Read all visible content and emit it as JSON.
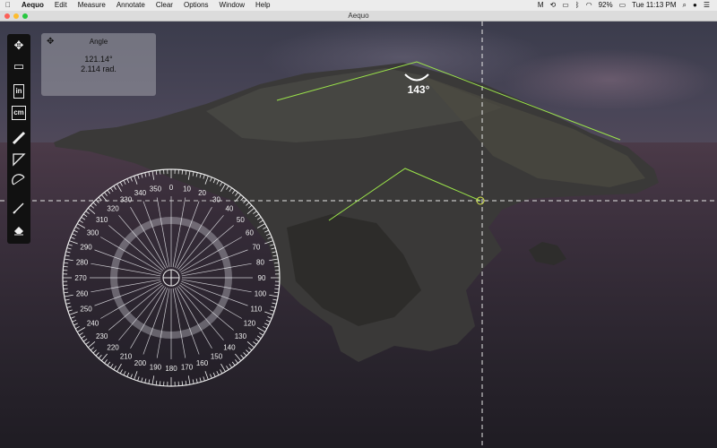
{
  "menubar": {
    "apple": "",
    "app_name": "Aequo",
    "items": [
      "Edit",
      "Measure",
      "Annotate",
      "Clear",
      "Options",
      "Window",
      "Help"
    ],
    "battery": "92%",
    "clock": "Tue 11:13 PM"
  },
  "window": {
    "title": "Aequo"
  },
  "toolbar": {
    "tools": [
      {
        "name": "move-tool",
        "icon": "✥"
      },
      {
        "name": "horizontal-ruler-tool",
        "icon": "▭"
      },
      {
        "name": "inch-ruler-tool",
        "icon": "in"
      },
      {
        "name": "cm-ruler-tool",
        "icon": "cm"
      },
      {
        "name": "ruler-tool",
        "icon": "📏"
      },
      {
        "name": "triangle-tool",
        "icon": "◺"
      },
      {
        "name": "protractor-tool",
        "icon": "◓"
      },
      {
        "name": "pencil-tool",
        "icon": "✎"
      },
      {
        "name": "eraser-tool",
        "icon": "⌫"
      }
    ]
  },
  "info_panel": {
    "move_icon": "✥",
    "title": "Angle",
    "degrees": "121.14°",
    "radians": "2.114 rad."
  },
  "annotation": {
    "label": "143°"
  },
  "protractor": {
    "labels": [
      "0",
      "10",
      "20",
      "30",
      "40",
      "50",
      "60",
      "70",
      "80",
      "90",
      "100",
      "110",
      "120",
      "130",
      "140",
      "150",
      "160",
      "170",
      "180",
      "190",
      "200",
      "210",
      "220",
      "230",
      "240",
      "250",
      "260",
      "270",
      "280",
      "290",
      "300",
      "310",
      "320",
      "330",
      "340",
      "350"
    ]
  },
  "colors": {
    "measure_line": "#9be44a",
    "menubar_bg": "#ececec",
    "toolbar_bg": "#111111"
  }
}
